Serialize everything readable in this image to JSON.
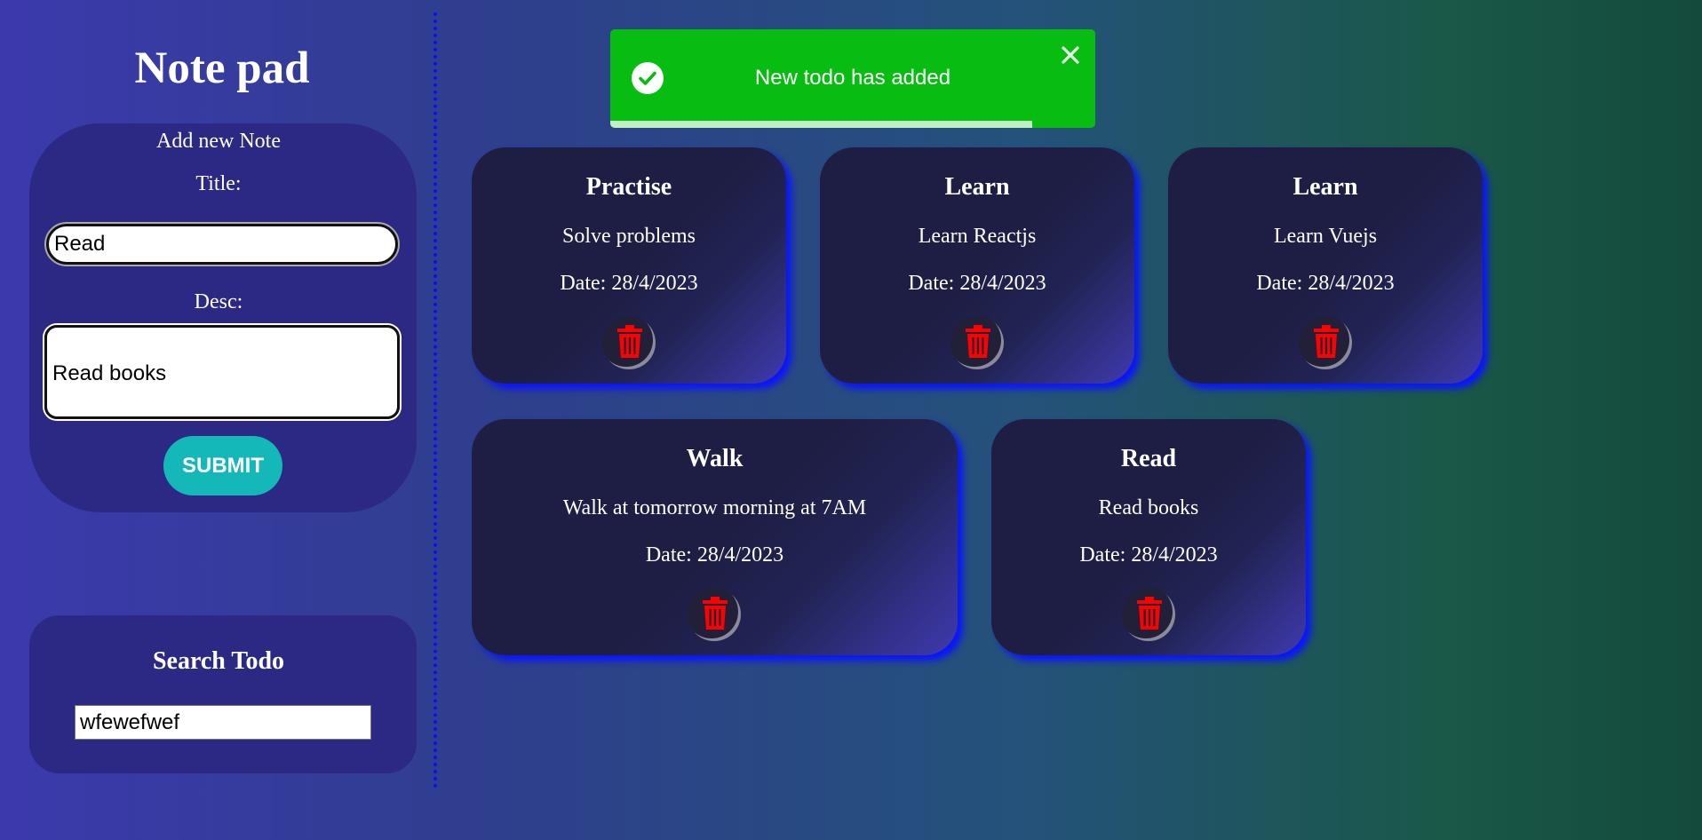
{
  "app": {
    "title": "Note pad"
  },
  "add_note": {
    "heading": "Add new Note",
    "title_label": "Title:",
    "title_value": "Read",
    "desc_label": "Desc:",
    "desc_value": "Read books",
    "submit_label": "SUBMIT"
  },
  "search": {
    "heading": "Search Todo",
    "value": "wfewefwef"
  },
  "toast": {
    "message": "New todo has added",
    "close_glyph": "✕",
    "color": "#08bd12",
    "progress": 0.87
  },
  "todos": [
    {
      "title": "Practise",
      "desc": "Solve problems",
      "date": "Date: 28/4/2023"
    },
    {
      "title": "Learn",
      "desc": "Learn Reactjs",
      "date": "Date: 28/4/2023"
    },
    {
      "title": "Learn",
      "desc": "Learn Vuejs",
      "date": "Date: 28/4/2023"
    },
    {
      "title": "Walk",
      "desc": "Walk at tomorrow morning at 7AM",
      "date": "Date: 28/4/2023"
    },
    {
      "title": "Read",
      "desc": "Read books",
      "date": "Date: 28/4/2023"
    }
  ],
  "icons": {
    "delete": "trash-icon",
    "success": "check-circle-icon",
    "close": "close-icon"
  },
  "colors": {
    "delete_icon": "#ff0000",
    "card_glow": "#0a14ff",
    "submit": "#14b8b8"
  }
}
